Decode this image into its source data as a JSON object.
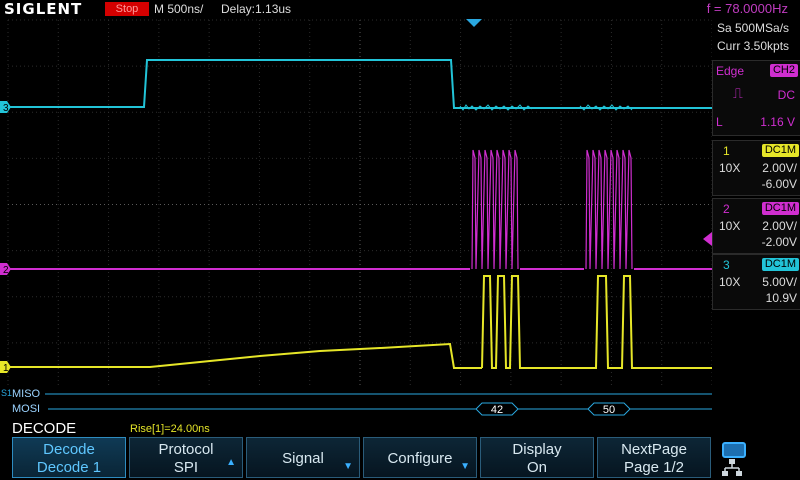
{
  "topbar": {
    "brand": "SIGLENT",
    "run_state": "Stop",
    "timebase": "M 500ns/",
    "delay": "Delay:1.13us",
    "frequency": "f = 78.0000Hz"
  },
  "acquisition": {
    "sample_rate": "Sa 500MSa/s",
    "memory": "Curr 3.50kpts"
  },
  "trigger": {
    "type": "Edge",
    "source": "CH2",
    "coupling": "DC",
    "level_label": "L",
    "level": "1.16 V"
  },
  "channels": [
    {
      "num": "1",
      "coupling": "DC1M",
      "probe": "10X",
      "scale": "2.00V/",
      "offset": "-6.00V",
      "color": "#e6e628"
    },
    {
      "num": "2",
      "coupling": "DC1M",
      "probe": "10X",
      "scale": "2.00V/",
      "offset": "-2.00V",
      "color": "#d02ed0"
    },
    {
      "num": "3",
      "coupling": "DC1M",
      "probe": "10X",
      "scale": "5.00V/",
      "offset": "10.9V",
      "color": "#22c4d8"
    }
  ],
  "markers": {
    "ch1": "1",
    "ch2": "2",
    "ch3": "3",
    "serial": "S1"
  },
  "decode_bus": {
    "miso_label": "MISO",
    "mosi_label": "MOSI",
    "values": [
      "42",
      "50"
    ]
  },
  "decode": {
    "title": "DECODE",
    "measurement": "Rise[1]=24.00ns"
  },
  "softkeys": [
    {
      "line1": "Decode",
      "line2": "Decode 1",
      "active": true
    },
    {
      "line1": "Protocol",
      "line2": "SPI",
      "arrow": "up"
    },
    {
      "line1": "Signal",
      "line2": "",
      "arrow": "down"
    },
    {
      "line1": "Configure",
      "line2": "",
      "arrow": "down"
    },
    {
      "line1": "Display",
      "line2": "On"
    },
    {
      "line1": "NextPage",
      "line2": "Page 1/2"
    }
  ]
}
